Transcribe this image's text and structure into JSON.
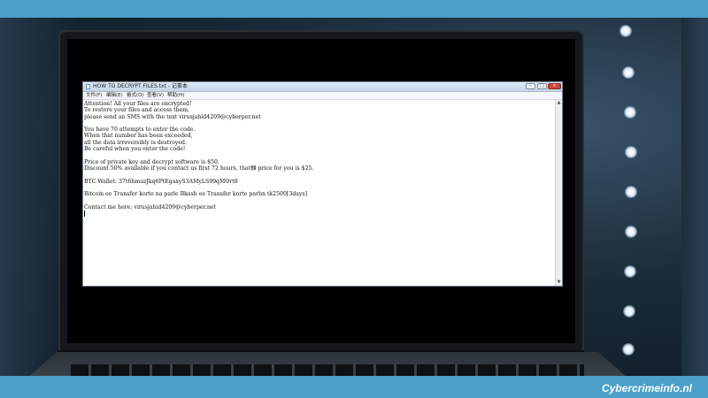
{
  "watermark": {
    "text": "Cybercrimeinfo.nl"
  },
  "window": {
    "title": "HOW TO DECRYPT FILES.txt - 记事本",
    "controls": {
      "minimize": "–",
      "maximize": "□",
      "close": "×"
    }
  },
  "menu": [
    {
      "label": "文件(F)"
    },
    {
      "label": "编辑(E)"
    },
    {
      "label": "格式(O)"
    },
    {
      "label": "查看(V)"
    },
    {
      "label": "帮助(H)"
    }
  ],
  "note_lines": [
    "Attention! All your files are encrypted!",
    "To restore your files and access them,",
    "please send an SMS with the text virusjahid4209@cyberper.net",
    "",
    "You have 70 attempts to enter the code.",
    "When that number has been exceeded,",
    "all the data irreversibly is destroyed.",
    "Be careful when you enter the code!",
    "",
    "Price of private key and decrypt software is $50.",
    "Discount 50% available if you contact us first 72 hours, that掴 price for you is $25.",
    "",
    "BTC Wallet: 37t6hmuzJkq6PtEgaxyS3AMyLS99qMOrt8",
    "",
    "Bitcoin ee Transfer korte na parle Bkash ee Transfer korte parbn tk2500[3days]",
    "",
    "Contact me here: virusjahid4209@cyberper.net"
  ],
  "colors": {
    "accent_band": "#4aa0c9",
    "notepad_bg": "#ffffff",
    "close_button": "#c8463d"
  },
  "icons": {
    "notepad": "notepad-icon",
    "minimize": "minimize-icon",
    "maximize": "maximize-icon",
    "close": "close-icon"
  }
}
